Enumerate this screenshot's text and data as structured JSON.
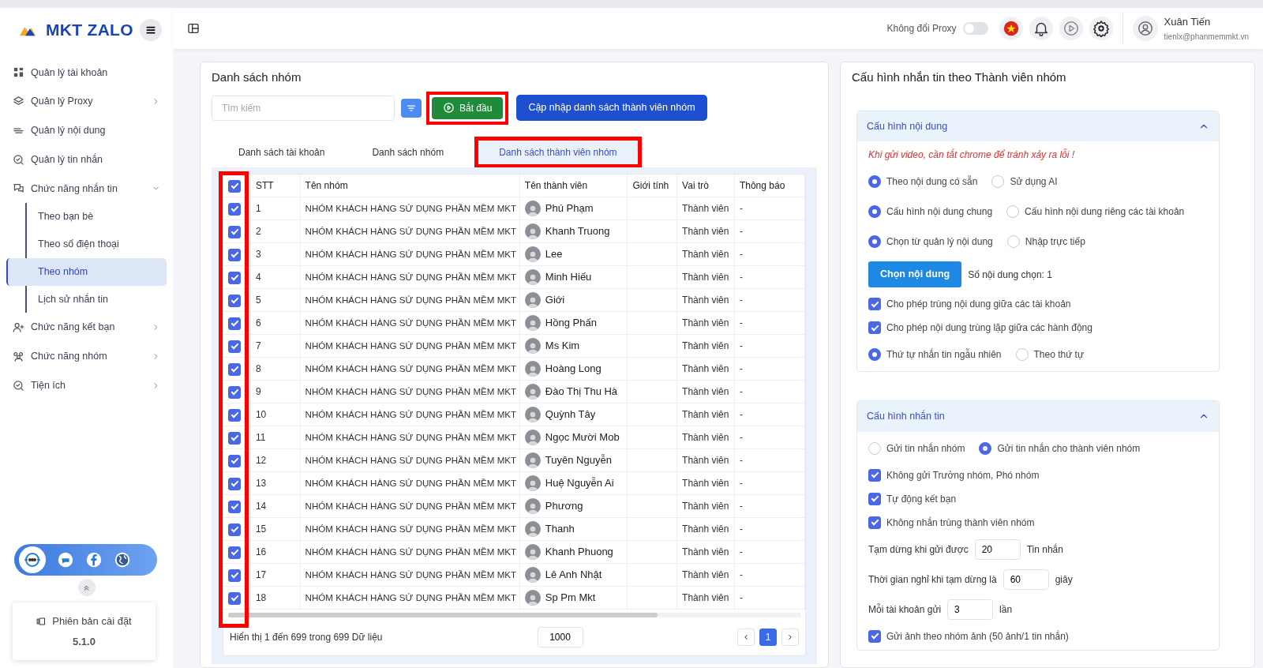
{
  "sidebar": {
    "logo": "MKT ZALO",
    "items": [
      {
        "label": "Quản lý tài khoản"
      },
      {
        "label": "Quản lý Proxy",
        "expanded": false
      },
      {
        "label": "Quản lý nội dung"
      },
      {
        "label": "Quản lý tin nhắn"
      },
      {
        "label": "Chức năng nhắn tin",
        "expanded": true,
        "children": [
          {
            "label": "Theo bạn bè",
            "selected": false
          },
          {
            "label": "Theo số điện thoại",
            "selected": false
          },
          {
            "label": "Theo nhóm",
            "selected": true
          },
          {
            "label": "Lịch sử nhắn tin",
            "selected": false
          }
        ]
      },
      {
        "label": "Chức năng kết bạn",
        "expanded": false
      },
      {
        "label": "Chức năng nhóm",
        "expanded": false
      },
      {
        "label": "Tiện ích",
        "expanded": false
      }
    ],
    "version_label": "Phiên bản cài đặt",
    "version": "5.1.0"
  },
  "topbar": {
    "proxy_label": "Không đổi Proxy",
    "proxy_on": false,
    "user_name": "Xuân Tiến",
    "user_email": "tienlx@phanmemmkt.vn"
  },
  "left_panel": {
    "title": "Danh sách nhóm",
    "search": {
      "placeholder": "Tìm kiếm"
    },
    "start_button": {
      "label": "Bắt đầu",
      "highlighted": true
    },
    "update_button": "Cập nhập danh sách thành viên nhóm",
    "tabs": [
      {
        "label": "Danh sách tài khoản",
        "selected": false,
        "highlighted": false
      },
      {
        "label": "Danh sách nhóm",
        "selected": false,
        "highlighted": false
      },
      {
        "label": "Danh sách thành viên nhóm",
        "selected": true,
        "highlighted": true
      }
    ],
    "table": {
      "columns": [
        "STT",
        "Tên nhóm",
        "Tên thành viên",
        "Giới tính",
        "Vai trò",
        "Thông báo"
      ],
      "all_checked": true,
      "checkbox_column_highlighted": true,
      "rows": [
        {
          "checked": true,
          "stt": "1",
          "group": "NHÓM KHÁCH HÀNG SỬ DỤNG PHẦN MỀM MKT",
          "member": "Phú Phạm",
          "role": "Thành viên",
          "notice": "-"
        },
        {
          "checked": true,
          "stt": "2",
          "group": "NHÓM KHÁCH HÀNG SỬ DỤNG PHẦN MỀM MKT",
          "member": "Khanh Truong",
          "role": "Thành viên",
          "notice": "-"
        },
        {
          "checked": true,
          "stt": "3",
          "group": "NHÓM KHÁCH HÀNG SỬ DỤNG PHẦN MỀM MKT",
          "member": "Lee",
          "role": "Thành viên",
          "notice": "-"
        },
        {
          "checked": true,
          "stt": "4",
          "group": "NHÓM KHÁCH HÀNG SỬ DỤNG PHẦN MỀM MKT",
          "member": "Minh Hiếu",
          "role": "Thành viên",
          "notice": "-"
        },
        {
          "checked": true,
          "stt": "5",
          "group": "NHÓM KHÁCH HÀNG SỬ DỤNG PHẦN MỀM MKT",
          "member": "Giới",
          "role": "Thành viên",
          "notice": "-"
        },
        {
          "checked": true,
          "stt": "6",
          "group": "NHÓM KHÁCH HÀNG SỬ DỤNG PHẦN MỀM MKT",
          "member": "Hồng Phấn",
          "role": "Thành viên",
          "notice": "-"
        },
        {
          "checked": true,
          "stt": "7",
          "group": "NHÓM KHÁCH HÀNG SỬ DỤNG PHẦN MỀM MKT",
          "member": "Ms Kim",
          "role": "Thành viên",
          "notice": "-"
        },
        {
          "checked": true,
          "stt": "8",
          "group": "NHÓM KHÁCH HÀNG SỬ DỤNG PHẦN MỀM MKT",
          "member": "Hoàng Long",
          "role": "Thành viên",
          "notice": "-"
        },
        {
          "checked": true,
          "stt": "9",
          "group": "NHÓM KHÁCH HÀNG SỬ DỤNG PHẦN MỀM MKT",
          "member": "Đào Thị Thu Hà",
          "role": "Thành viên",
          "notice": "-"
        },
        {
          "checked": true,
          "stt": "10",
          "group": "NHÓM KHÁCH HÀNG SỬ DỤNG PHẦN MỀM MKT",
          "member": "Quỳnh Tây",
          "role": "Thành viên",
          "notice": "-"
        },
        {
          "checked": true,
          "stt": "11",
          "group": "NHÓM KHÁCH HÀNG SỬ DỤNG PHẦN MỀM MKT",
          "member": "Ngọc Mười Mob",
          "role": "Thành viên",
          "notice": "-"
        },
        {
          "checked": true,
          "stt": "12",
          "group": "NHÓM KHÁCH HÀNG SỬ DỤNG PHẦN MỀM MKT",
          "member": "Tuyên Nguyễn",
          "role": "Thành viên",
          "notice": "-"
        },
        {
          "checked": true,
          "stt": "13",
          "group": "NHÓM KHÁCH HÀNG SỬ DỤNG PHẦN MỀM MKT",
          "member": "Huệ Nguyễn Ai",
          "role": "Thành viên",
          "notice": "-"
        },
        {
          "checked": true,
          "stt": "14",
          "group": "NHÓM KHÁCH HÀNG SỬ DỤNG PHẦN MỀM MKT",
          "member": "Phương",
          "role": "Thành viên",
          "notice": "-"
        },
        {
          "checked": true,
          "stt": "15",
          "group": "NHÓM KHÁCH HÀNG SỬ DỤNG PHẦN MỀM MKT",
          "member": "Thanh",
          "role": "Thành viên",
          "notice": "-"
        },
        {
          "checked": true,
          "stt": "16",
          "group": "NHÓM KHÁCH HÀNG SỬ DỤNG PHẦN MỀM MKT",
          "member": "Khanh Phuong",
          "role": "Thành viên",
          "notice": "-"
        },
        {
          "checked": true,
          "stt": "17",
          "group": "NHÓM KHÁCH HÀNG SỬ DỤNG PHẦN MỀM MKT",
          "member": "Lê Anh Nhật",
          "role": "Thành viên",
          "notice": "-"
        },
        {
          "checked": true,
          "stt": "18",
          "group": "NHÓM KHÁCH HÀNG SỬ DỤNG PHẦN MỀM MKT",
          "member": "Sp Pm Mkt",
          "role": "Thành viên",
          "notice": "-"
        }
      ]
    },
    "summary": "Hiển thị 1 đến 699 trong 699 Dữ liệu",
    "page_size": "1000",
    "pages": [
      {
        "label": "1",
        "selected": true
      }
    ]
  },
  "right_panel": {
    "title": "Cấu hình nhắn tin theo Thành viên nhóm",
    "sections": [
      {
        "title": "Cấu hình nội dung",
        "expanded": true,
        "items": [
          {
            "kind": "note",
            "text": "Khi gửi video, cần tắt chrome để tránh xảy ra lỗi !"
          },
          {
            "kind": "radio",
            "options": [
              {
                "label": "Theo nội dung có sẵn",
                "selected": true
              },
              {
                "label": "Sử dụng AI",
                "selected": false
              }
            ]
          },
          {
            "kind": "radio",
            "options": [
              {
                "label": "Cấu hình nội dung chung",
                "selected": true
              },
              {
                "label": "Cấu hình nội dung riêng các tài khoản",
                "selected": false
              }
            ]
          },
          {
            "kind": "radio",
            "options": [
              {
                "label": "Chọn từ quản lý nội dung",
                "selected": true
              },
              {
                "label": "Nhập trực tiếp",
                "selected": false
              }
            ]
          },
          {
            "kind": "button",
            "label": "Chọn nội dung",
            "text": "Số nội dung chọn: 1"
          },
          {
            "kind": "checkbox",
            "label": "Cho phép trùng nội dung giữa các tài khoản",
            "checked": true
          },
          {
            "kind": "checkbox",
            "label": "Cho phép nội dung trùng lặp giữa các hành động",
            "checked": true
          },
          {
            "kind": "radio",
            "options": [
              {
                "label": "Thứ tự nhắn tin ngẫu nhiên",
                "selected": true
              },
              {
                "label": "Theo thứ tự",
                "selected": false
              }
            ]
          }
        ]
      },
      {
        "title": "Cấu hình nhắn tin",
        "expanded": true,
        "items": [
          {
            "kind": "radio",
            "options": [
              {
                "label": "Gửi tin nhắn nhóm",
                "selected": false
              },
              {
                "label": "Gửi tin nhắn cho thành viên nhóm",
                "selected": true
              }
            ]
          },
          {
            "kind": "checkbox",
            "label": "Không gửi Trưởng nhóm, Phó nhóm",
            "checked": true
          },
          {
            "kind": "checkbox",
            "label": "Tự động kết bạn",
            "checked": true
          },
          {
            "kind": "checkbox",
            "label": "Không nhắn trùng thành viên nhóm",
            "checked": true
          },
          {
            "kind": "number",
            "label": "Tạm dừng khi gửi được",
            "value": "20",
            "unit": "Tin nhắn"
          },
          {
            "kind": "number",
            "label": "Thời gian nghỉ khi tạm dừng là",
            "value": "60",
            "unit": "giây"
          },
          {
            "kind": "number",
            "label": "Mỗi tài khoản gửi",
            "value": "3",
            "unit": "lần"
          },
          {
            "kind": "checkbox",
            "label": "Gửi ảnh theo nhóm ảnh (50 ảnh/1 tin nhắn)",
            "checked": true
          }
        ]
      }
    ]
  }
}
